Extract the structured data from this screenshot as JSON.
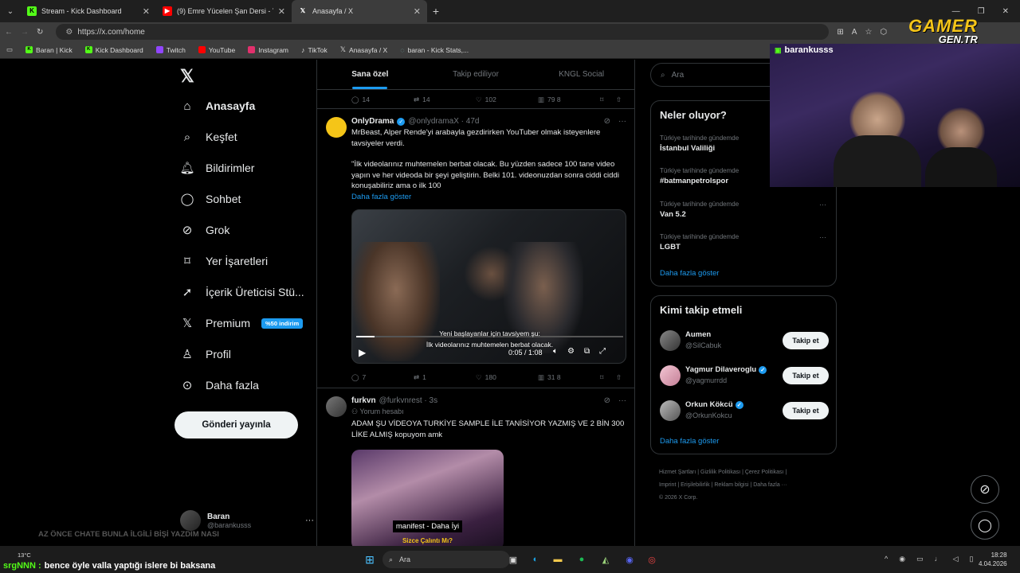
{
  "browser": {
    "tabs": [
      {
        "label": "Stream - Kick Dashboard",
        "favicon": "kick-icon"
      },
      {
        "label": "(9) Emre Yücelen Şan Dersi - YouT",
        "favicon": "youtube-icon"
      },
      {
        "label": "Anasayfa / X",
        "favicon": "x-icon"
      }
    ],
    "url": "https://x.com/home",
    "bookmarks": [
      "Baran | Kick",
      "Kick Dashboard",
      "Twitch",
      "YouTube",
      "Instagram",
      "TikTok",
      "Anasayfa / X",
      "baran - Kick Stats,..."
    ]
  },
  "nav": {
    "items": [
      "Anasayfa",
      "Keşfet",
      "Bildirimler",
      "Sohbet",
      "Grok",
      "Yer İşaretleri",
      "İçerik Üreticisi Stü...",
      "Premium",
      "Profil",
      "Daha fazla"
    ],
    "premium_badge": "%50 indirim",
    "post_button": "Gönderi yayınla",
    "account_name": "Baran",
    "account_handle": "@barankusss",
    "more": "···"
  },
  "timeline": {
    "tabs": [
      "Sana özel",
      "Takip ediliyor",
      "KNGL Social"
    ],
    "prev_actions": {
      "replies": "14",
      "reposts": "14",
      "likes": "102",
      "views": "79 8"
    },
    "tweet1": {
      "name": "OnlyDrama",
      "handle": "@onlydramaX · 47d",
      "text1": "MrBeast, Alper Rende'yi arabayla gezdirirken YouTuber olmak isteyenlere tavsiyeler verdi.",
      "text2": "\"İlk videolarınız muhtemelen berbat olacak. Bu yüzden sadece 100 tane video yapın ve her videoda bir şeyi geliştirin. Belki 101. videonuzdan sonra ciddi ciddi konuşabiliriz ama o ilk 100",
      "show_more": "Daha fazla göster",
      "caption1": "Yeni başlayanlar için tavsiyem şu:",
      "caption2": "İlk videolarınız muhtemelen berbat olacak.",
      "time": "0:05 / 1:08",
      "replies": "7",
      "reposts": "1",
      "likes": "180",
      "views": "31 8"
    },
    "tweet2": {
      "name": "furkvn",
      "handle": "@furkvnrest · 3s",
      "context": "Yorum hesabı",
      "text": "ADAM ŞU VİDEOYA TURKİYE SAMPLE İLE TANİSİYOR YAZMIŞ VE 2 BİN 300 LİKE ALMIŞ kopuyom amk",
      "card_title": "manifest - Daha İyi",
      "card_sub": "Sizce Çalıntı Mı?"
    }
  },
  "right": {
    "search_placeholder": "Ara",
    "trends_title": "Neler oluyor?",
    "trends": [
      {
        "cat": "Türkiye tarihinde gündemde",
        "name": "İstanbul Valiliği"
      },
      {
        "cat": "Türkiye tarihinde gündemde",
        "name": "#batmanpetrolspor"
      },
      {
        "cat": "Türkiye tarihinde gündemde",
        "name": "Van 5.2"
      },
      {
        "cat": "Türkiye tarihinde gündemde",
        "name": "LGBT"
      }
    ],
    "trends_more": "Daha fazla göster",
    "who_title": "Kimi takip etmeli",
    "who": [
      {
        "name": "Aumen",
        "handle": "@SilCabuk"
      },
      {
        "name": "Yagmur Dilaveroglu",
        "handle": "@yagmurrdd"
      },
      {
        "name": "Orkun Kökcü",
        "handle": "@OrkunKokcu"
      }
    ],
    "follow_label": "Takip et",
    "who_more": "Daha fazla göster",
    "footer1": "Hizmet Şartları | Gizlilik Politikası | Çerez Politikası |",
    "footer2": "Imprint | Erişilebilirlik | Reklam bilgisi | Daha fazla ···",
    "footer3": "© 2026 X Corp."
  },
  "overlay": {
    "logo1": "GAMER",
    "logo2": "GEN.TR",
    "cam_name": "barankusss",
    "chat1": "AZ ÖNCE CHATE BUNLA İLGİLİ BİŞİ YAZDIM NASI",
    "chat_user": "srgNNN :",
    "chat2": "bence öyle valla yaptığı islere bi baksana"
  },
  "taskbar": {
    "weather": "13°C",
    "search": "Ara",
    "time": "18:28",
    "date": "4.04.2026"
  }
}
